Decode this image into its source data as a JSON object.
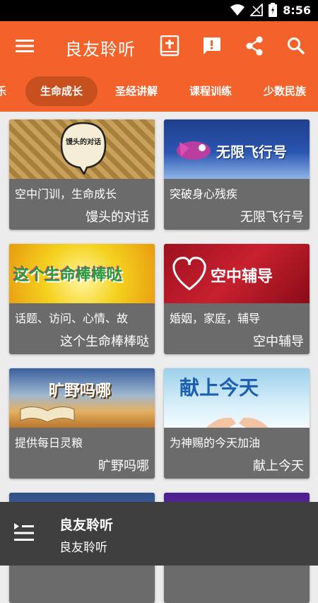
{
  "status": {
    "time": "8:56"
  },
  "app_bar": {
    "title": "良友聆听",
    "icons": [
      "menu-icon",
      "bible-icon",
      "feedback-icon",
      "share-icon",
      "search-icon"
    ],
    "color": "#f2622a"
  },
  "tabs": {
    "items": [
      "乐",
      "生命成长",
      "圣经讲解",
      "课程训练",
      "少数民族"
    ],
    "active": "生命成长"
  },
  "cards": [
    {
      "subtitle": "空中门训，生命成长",
      "title": "馒头的对话",
      "thumb_text": "馒头的对话"
    },
    {
      "subtitle": "突破身心残疾",
      "title": "无限飞行号",
      "thumb_text": "无限飞行号"
    },
    {
      "subtitle": "话题、访问、心情、故",
      "title": "这个生命棒棒哒",
      "thumb_text": "这个生命棒棒哒"
    },
    {
      "subtitle": "婚姻，家庭，辅导",
      "title": "空中辅导",
      "thumb_text": "空中辅导"
    },
    {
      "subtitle": "提供每日灵粮",
      "title": "旷野吗哪",
      "thumb_text": "旷野吗哪"
    },
    {
      "subtitle": "为神赐的今天加油",
      "title": "献上今天",
      "thumb_text": "献上今天"
    }
  ],
  "player": {
    "title": "良友聆听",
    "subtitle": "良友聆听",
    "icon": "playlist-icon"
  }
}
